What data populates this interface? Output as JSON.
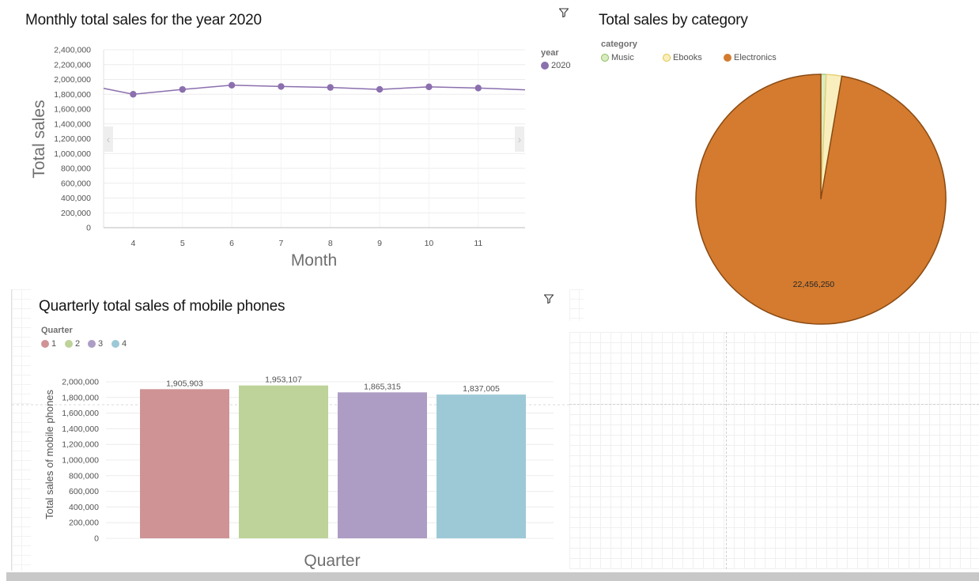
{
  "line_panel": {
    "title": "Monthly total sales for the year 2020",
    "legend_title": "year",
    "legend_label": "2020",
    "nav_prev_icon": "‹",
    "nav_next_icon": "›"
  },
  "pie_panel": {
    "title": "Total sales by category",
    "legend_title": "category",
    "legend_items": [
      "Music",
      "Ebooks",
      "Electronics"
    ]
  },
  "bar_panel": {
    "title": "Quarterly total sales of mobile phones",
    "legend_title": "Quarter",
    "legend_items": [
      "1",
      "2",
      "3",
      "4"
    ]
  },
  "icons": {
    "filter": "filter-icon"
  },
  "colors": {
    "line": "#8b6fae",
    "music": "#d9ebc1",
    "ebooks": "#f9efbe",
    "electronics": "#d47b2f",
    "electronics_stroke": "#8a4a12",
    "q1": "#cf9396",
    "q2": "#bdd39a",
    "q3": "#ad9dc4",
    "q4": "#9dc9d7"
  },
  "chart_data": [
    {
      "type": "line",
      "title": "Monthly total sales for the year 2020",
      "xlabel": "Month",
      "ylabel": "Total sales",
      "x": [
        4,
        5,
        6,
        7,
        8,
        9,
        10,
        11
      ],
      "xlim": [
        3.4,
        11.95
      ],
      "series": [
        {
          "name": "2020",
          "values": [
            1800000,
            1865000,
            1922000,
            1905000,
            1892000,
            1866000,
            1900000,
            1884000
          ]
        }
      ],
      "edge_values": {
        "left": 1880000,
        "right": 1860000
      },
      "ylim": [
        0,
        2400000
      ],
      "yticks": [
        0,
        200000,
        400000,
        600000,
        800000,
        1000000,
        1200000,
        1400000,
        1600000,
        1800000,
        2000000,
        2200000,
        2400000
      ],
      "ytick_labels": [
        "0",
        "200,000",
        "400,000",
        "600,000",
        "800,000",
        "1,000,000",
        "1,200,000",
        "1,400,000",
        "1,600,000",
        "1,800,000",
        "2,000,000",
        "2,200,000",
        "2,400,000"
      ],
      "grid": true,
      "legend": "top-right"
    },
    {
      "type": "pie",
      "title": "Total sales by category",
      "categories": [
        "Music",
        "Ebooks",
        "Electronics"
      ],
      "values": [
        160000,
        460000,
        22456250
      ],
      "data_labels": [
        "",
        "",
        "22,456,250"
      ],
      "legend": "top-left"
    },
    {
      "type": "bar",
      "title": "Quarterly total sales of mobile phones",
      "xlabel": "Quarter",
      "ylabel": "Total sales of mobile phones",
      "categories": [
        "1",
        "2",
        "3",
        "4"
      ],
      "values": [
        1905903,
        1953107,
        1865315,
        1837005
      ],
      "data_labels": [
        "1,905,903",
        "1,953,107",
        "1,865,315",
        "1,837,005"
      ],
      "ylim": [
        0,
        2000000
      ],
      "yticks": [
        0,
        200000,
        400000,
        600000,
        800000,
        1000000,
        1200000,
        1400000,
        1600000,
        1800000,
        2000000
      ],
      "ytick_labels": [
        "0",
        "200,000",
        "400,000",
        "600,000",
        "800,000",
        "1,000,000",
        "1,200,000",
        "1,400,000",
        "1,600,000",
        "1,800,000",
        "2,000,000"
      ],
      "grid": true,
      "legend": "top-left"
    }
  ]
}
